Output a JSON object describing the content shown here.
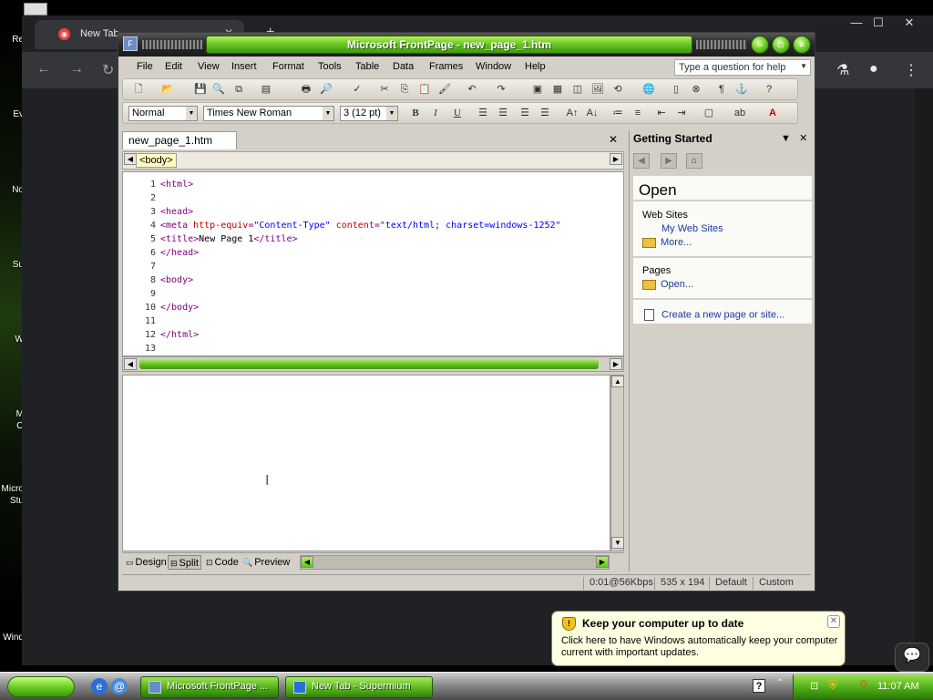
{
  "desktop": {
    "icons": [
      "Re",
      "Ev",
      "No",
      "Su",
      "W",
      "M",
      "O",
      "Micro",
      "Stu",
      "Wind"
    ]
  },
  "browser": {
    "tab_title": "New Tab",
    "new_tab": "+",
    "controls": {
      "minimize": "—",
      "maximize": "☐",
      "close": "✕"
    },
    "nav": {
      "back": "←",
      "forward": "→",
      "reload": "↻"
    },
    "side": {
      "labs": "⚗",
      "profile": "●",
      "menu": "⋮"
    }
  },
  "frontpage": {
    "title": "Microsoft FrontPage - new_page_1.htm",
    "menu": [
      "File",
      "Edit",
      "View",
      "Insert",
      "Format",
      "Tools",
      "Table",
      "Data",
      "Frames",
      "Window",
      "Help"
    ],
    "question_box": "Type a question for help",
    "style_select": "Normal",
    "font_select": "Times New Roman",
    "size_select": "3  (12 pt)",
    "format_buttons": {
      "bold": "B",
      "italic": "I",
      "underline": "U"
    },
    "doc_tab": "new_page_1.htm",
    "tag_selector": "<body>",
    "code_lines": [
      {
        "n": "1",
        "parts": [
          [
            "t",
            "<html>"
          ]
        ]
      },
      {
        "n": "2",
        "parts": []
      },
      {
        "n": "3",
        "parts": [
          [
            "t",
            "<head>"
          ]
        ]
      },
      {
        "n": "4",
        "parts": [
          [
            "t",
            "<meta "
          ],
          [
            "a",
            "http-equiv"
          ],
          [
            "t",
            "="
          ],
          [
            "v",
            "\"Content-Type\""
          ],
          [
            "t",
            " "
          ],
          [
            "a",
            "content"
          ],
          [
            "t",
            "="
          ],
          [
            "v",
            "\"text/html; charset=windows-1252\""
          ]
        ]
      },
      {
        "n": "5",
        "parts": [
          [
            "t",
            "<title>"
          ],
          [
            "x",
            "New Page 1"
          ],
          [
            "t",
            "</title>"
          ]
        ]
      },
      {
        "n": "6",
        "parts": [
          [
            "t",
            "</head>"
          ]
        ]
      },
      {
        "n": "7",
        "parts": []
      },
      {
        "n": "8",
        "parts": [
          [
            "t",
            "<body>"
          ]
        ]
      },
      {
        "n": "9",
        "parts": []
      },
      {
        "n": "10",
        "parts": [
          [
            "t",
            "</body>"
          ]
        ]
      },
      {
        "n": "11",
        "parts": []
      },
      {
        "n": "12",
        "parts": [
          [
            "t",
            "</html>"
          ]
        ]
      },
      {
        "n": "13",
        "parts": []
      }
    ],
    "views": [
      "Design",
      "Split",
      "Code",
      "Preview"
    ],
    "active_view": "Split",
    "status": {
      "speed": "0:01@56Kbps",
      "size": "535 x 194",
      "mode1": "Default",
      "mode2": "Custom"
    }
  },
  "task_pane": {
    "title": "Getting Started",
    "heading": "Open",
    "web_sites_label": "Web Sites",
    "my_web_sites": "My Web Sites",
    "more": "More...",
    "pages_label": "Pages",
    "open_link": "Open...",
    "create_link": "Create a new page or site..."
  },
  "balloon": {
    "title": "Keep your computer up to date",
    "text": "Click here to have Windows automatically keep your computer current with important updates."
  },
  "taskbar": {
    "buttons": [
      "Microsoft FrontPage ...",
      "New Tab - Supermium"
    ],
    "clock": "11:07 AM",
    "help": "?"
  },
  "colors": {
    "accent_green": "#64c423",
    "tag": "#800080",
    "attr": "#c00000",
    "value": "#0000ff"
  }
}
